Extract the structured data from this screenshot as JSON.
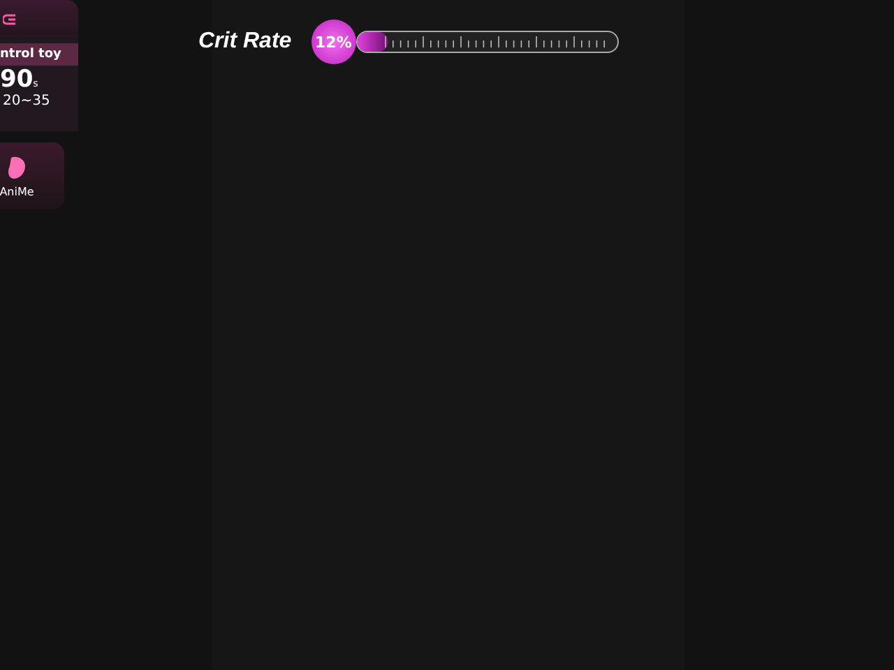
{
  "control_card": {
    "title": "ntrol toy",
    "value": "90",
    "unit": "s",
    "range": "20~35"
  },
  "toy_card": {
    "label": "AniMe"
  },
  "meter": {
    "label": "Crit Rate",
    "reading": "12%",
    "level": 0.12
  }
}
